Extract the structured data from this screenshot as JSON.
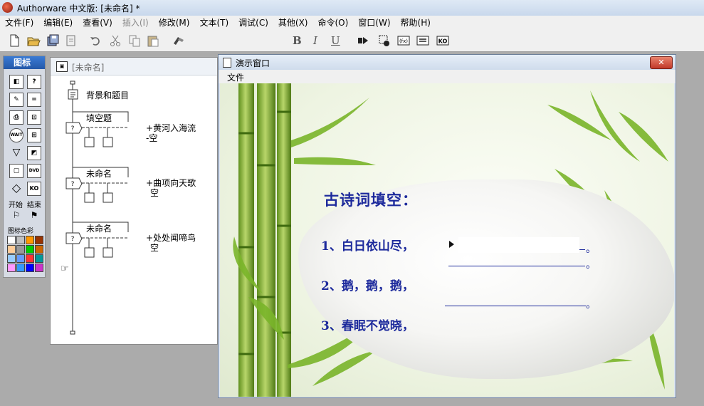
{
  "app": {
    "title": "Authorware 中文版: [未命名] *"
  },
  "menubar": {
    "items": [
      {
        "label": "文件(F)",
        "enabled": true
      },
      {
        "label": "编辑(E)",
        "enabled": true
      },
      {
        "label": "查看(V)",
        "enabled": true
      },
      {
        "label": "插入(I)",
        "enabled": false
      },
      {
        "label": "修改(M)",
        "enabled": true
      },
      {
        "label": "文本(T)",
        "enabled": true
      },
      {
        "label": "调试(C)",
        "enabled": true
      },
      {
        "label": "其他(X)",
        "enabled": true
      },
      {
        "label": "命令(O)",
        "enabled": true
      },
      {
        "label": "窗口(W)",
        "enabled": true
      },
      {
        "label": "帮助(H)",
        "enabled": true
      }
    ]
  },
  "toolbar": {
    "font_value": "",
    "bold": "B",
    "italic": "I",
    "underline": "U",
    "icons": [
      "new-icon",
      "open-icon",
      "save-all-icon",
      "import-icon",
      "undo-icon",
      "cut-icon",
      "copy-icon",
      "paste-icon",
      "find-icon",
      "run-icon",
      "control-panel-icon",
      "functions-icon",
      "variables-icon",
      "knowledge-objects-icon"
    ]
  },
  "palette": {
    "title": "图标",
    "start_label": "开始",
    "end_label": "结束",
    "color_label": "图标色彩",
    "icons": [
      {
        "name": "display-icon",
        "glyph": "D"
      },
      {
        "name": "motion-icon",
        "glyph": "?"
      },
      {
        "name": "erase-icon",
        "glyph": "E"
      },
      {
        "name": "wait-icon",
        "glyph": "="
      },
      {
        "name": "navigate-icon",
        "glyph": "N"
      },
      {
        "name": "framework-icon",
        "glyph": "F"
      },
      {
        "name": "decision-icon",
        "glyph": "WAIT"
      },
      {
        "name": "interaction-icon",
        "glyph": "IA"
      },
      {
        "name": "calculation-icon",
        "glyph": "▽"
      },
      {
        "name": "map-icon",
        "glyph": "M"
      },
      {
        "name": "digital-movie-icon",
        "glyph": "DM"
      },
      {
        "name": "sound-icon",
        "glyph": "DVD"
      },
      {
        "name": "video-icon",
        "glyph": "◇"
      },
      {
        "name": "ko-icon",
        "glyph": "KO"
      }
    ],
    "colors": [
      "#ffffff",
      "#c0c0c0",
      "#ff9900",
      "#993300",
      "#ffcc99",
      "#999999",
      "#00cc00",
      "#cc6600",
      "#99ccff",
      "#6699ff",
      "#ff3333",
      "#009999",
      "#ff99ff",
      "#3399ff",
      "#0000ff",
      "#cc33cc"
    ]
  },
  "flowline": {
    "title": "[未命名]",
    "first_icon_label": "背景和题目",
    "interactions": [
      {
        "label": "填空题",
        "branch": "黄河入海流",
        "branch_suffix": "空"
      },
      {
        "label": "未命名",
        "branch": "曲项向天歌",
        "branch_suffix": "空"
      },
      {
        "label": "未命名",
        "branch": "处处闻啼鸟",
        "branch_suffix": "空"
      }
    ]
  },
  "presentation": {
    "title": "演示窗口",
    "menu_label": "文件",
    "heading": "古诗词填空：",
    "questions": [
      {
        "number": "1、",
        "prompt": "白日依山尽，",
        "end": "。"
      },
      {
        "number": "2、",
        "prompt": "鹅，鹅，鹅，",
        "end": "。"
      },
      {
        "number": "3、",
        "prompt": "春眠不觉晓，",
        "end": "。"
      }
    ]
  }
}
